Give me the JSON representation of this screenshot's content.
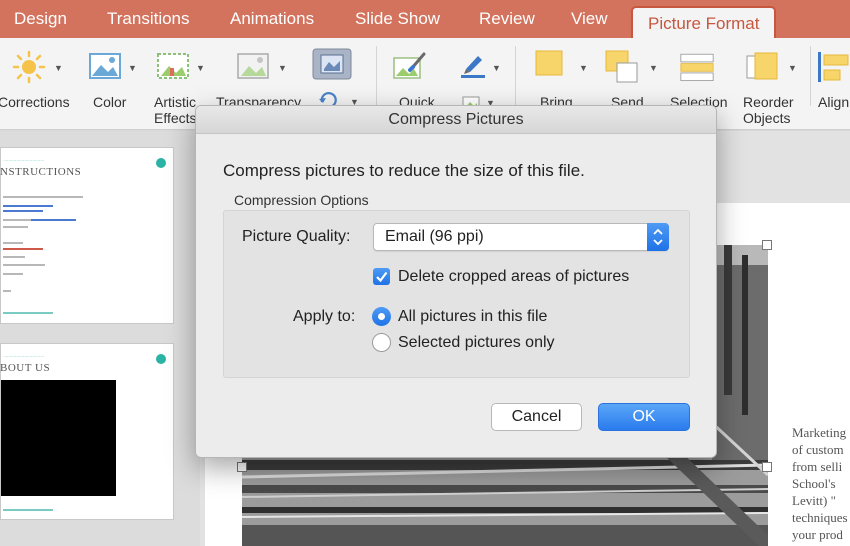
{
  "tabs": [
    {
      "label": "Design"
    },
    {
      "label": "Transitions"
    },
    {
      "label": "Animations"
    },
    {
      "label": "Slide Show"
    },
    {
      "label": "Review"
    },
    {
      "label": "View"
    },
    {
      "label": "Picture Format"
    }
  ],
  "active_tab": "Picture Format",
  "ribbon": {
    "corrections": "Corrections",
    "color": "Color",
    "artistic": "Artistic",
    "artistic2": "Effects",
    "transparency": "Transparency",
    "quick": "Quick",
    "bring": "Bring",
    "send": "Send",
    "selection": "Selection",
    "reorder": "Reorder",
    "reorder2": "Objects",
    "align": "Align"
  },
  "thumbnails": [
    {
      "title": "NSTRUCTIONS"
    },
    {
      "title": "BOUT US"
    }
  ],
  "slide_text": [
    "Marketing",
    "of custom",
    "from selli",
    "School's",
    "Levitt) \"",
    "techniques",
    "your prod"
  ],
  "dialog": {
    "title": "Compress Pictures",
    "intro": "Compress pictures to reduce the size of this file.",
    "group_label": "Compression Options",
    "quality_label": "Picture Quality:",
    "quality_value": "Email (96 ppi)",
    "delete_cropped": "Delete cropped areas of pictures",
    "apply_to_label": "Apply to:",
    "apply_all": "All pictures in this file",
    "apply_selected": "Selected pictures only",
    "cancel": "Cancel",
    "ok": "OK"
  },
  "state": {
    "delete_cropped_checked": true,
    "apply_to": "all"
  },
  "colors": {
    "tabbar": "#d3725d",
    "accent_blue": "#2a7bee",
    "teal": "#2bb3a5"
  },
  "icons": {
    "corrections": "sun-icon",
    "color": "picture-color-icon",
    "artistic": "artistic-effects-icon",
    "transparency": "transparency-icon",
    "crop": "crop-icon",
    "quick": "quick-styles-icon",
    "border": "border-pen-icon",
    "bring": "bring-forward-icon",
    "send": "send-backward-icon",
    "selection": "selection-pane-icon",
    "reorder": "reorder-objects-icon",
    "align": "align-icon"
  }
}
